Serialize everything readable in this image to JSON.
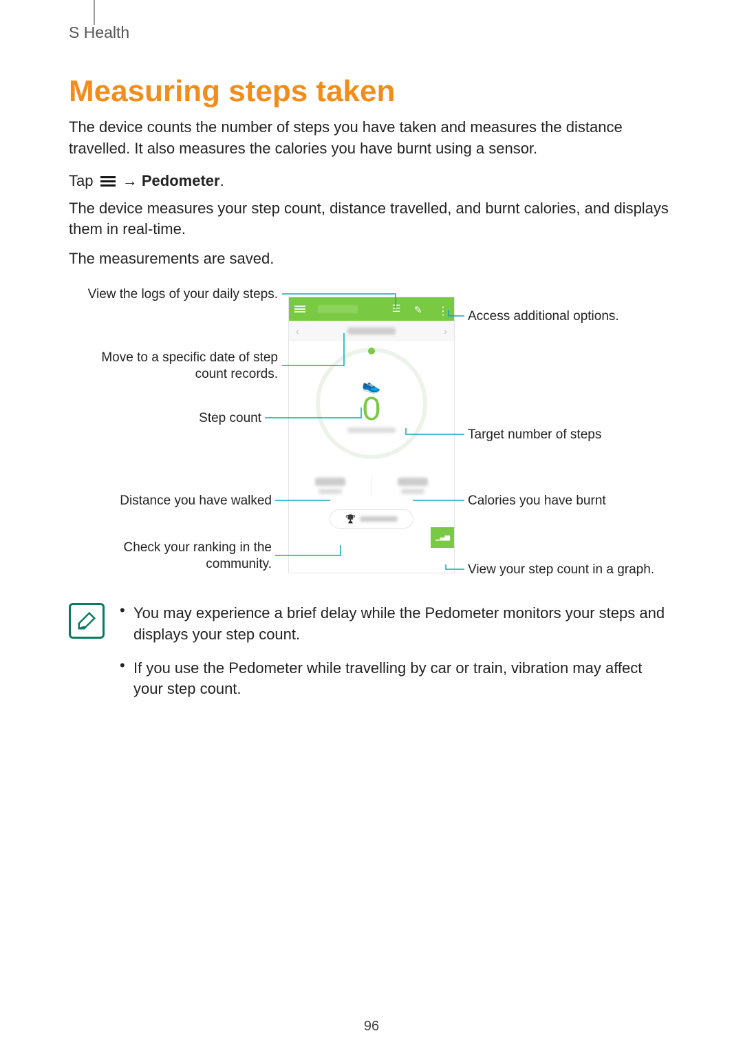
{
  "header": {
    "section": "S Health"
  },
  "title": "Measuring steps taken",
  "intro": "The device counts the number of steps you have taken and measures the distance travelled. It also measures the calories you have burnt using a sensor.",
  "tap": {
    "prefix": "Tap",
    "arrow": "→",
    "target": "Pedometer",
    "suffix": "."
  },
  "para2": "The device measures your step count, distance travelled, and burnt calories, and displays them in real-time.",
  "para3": "The measurements are saved.",
  "callouts": {
    "logs": "View the logs of your daily steps.",
    "options": "Access additional options.",
    "date1": "Move to a specific date of step",
    "date2": "count records.",
    "step_count": "Step count",
    "target": "Target number of steps",
    "distance": "Distance you have walked",
    "calories": "Calories you have burnt",
    "ranking1": "Check your ranking in the",
    "ranking2": "community.",
    "graph": "View your step count in a graph."
  },
  "screen": {
    "step_value": "0"
  },
  "notes": {
    "n1": "You may experience a brief delay while the Pedometer monitors your steps and displays your step count.",
    "n2": "If you use the Pedometer while travelling by car or train, vibration may affect your step count."
  },
  "page_number": "96"
}
